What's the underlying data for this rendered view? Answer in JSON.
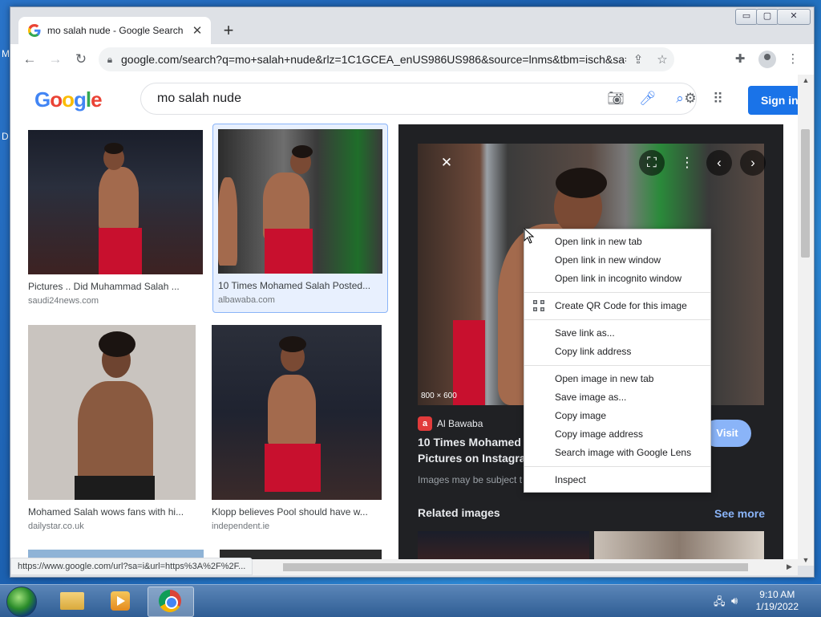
{
  "desktop": {
    "side_letters": [
      "M",
      "D"
    ]
  },
  "browser": {
    "tab": {
      "title": "mo salah nude - Google Search",
      "close": "✕"
    },
    "new_tab": "+",
    "window_controls": {
      "minimize": "▭",
      "maximize": "▢",
      "close": "✕"
    },
    "url": "google.com/search?q=mo+salah+nude&rlz=1C1GCEA_enUS986US986&source=lnms&tbm=isch&sa=X&ve...",
    "status_url": "https://www.google.com/url?sa=i&url=https%3A%2F%2F..."
  },
  "google": {
    "logo": [
      "G",
      "o",
      "o",
      "g",
      "l",
      "e"
    ],
    "query": "mo salah nude",
    "sign_in": "Sign in"
  },
  "results": [
    {
      "title": "Pictures .. Did Muhammad Salah ...",
      "source": "saudi24news.com"
    },
    {
      "title": "10 Times Mohamed Salah Posted...",
      "source": "albawaba.com"
    },
    {
      "title": "Mohamed Salah wows fans with hi...",
      "source": "dailystar.co.uk"
    },
    {
      "title": "Klopp believes Pool should have w...",
      "source": "independent.ie"
    }
  ],
  "preview": {
    "dimensions": "800 × 600",
    "source_icon": "a",
    "source_name": "Al Bawaba",
    "title_line1": "10 Times Mohamed S",
    "title_line2": "Pictures on Instagra",
    "note": "Images may be subject t",
    "visit": "Visit",
    "related": "Related images",
    "see_more": "See more"
  },
  "context_menu": {
    "group1": [
      "Open link in new tab",
      "Open link in new window",
      "Open link in incognito window"
    ],
    "group2": [
      "Create QR Code for this image"
    ],
    "group3": [
      "Save link as...",
      "Copy link address"
    ],
    "group4": [
      "Open image in new tab",
      "Save image as...",
      "Copy image",
      "Copy image address",
      "Search image with Google Lens"
    ],
    "group5": [
      "Inspect"
    ]
  },
  "taskbar": {
    "time": "9:10 AM",
    "date": "1/19/2022"
  },
  "colors": {
    "google_blue": "#1a73e8",
    "preview_bg": "#202124",
    "selected_bg": "#e8f0fe",
    "liverpool_red": "#c8102e"
  }
}
